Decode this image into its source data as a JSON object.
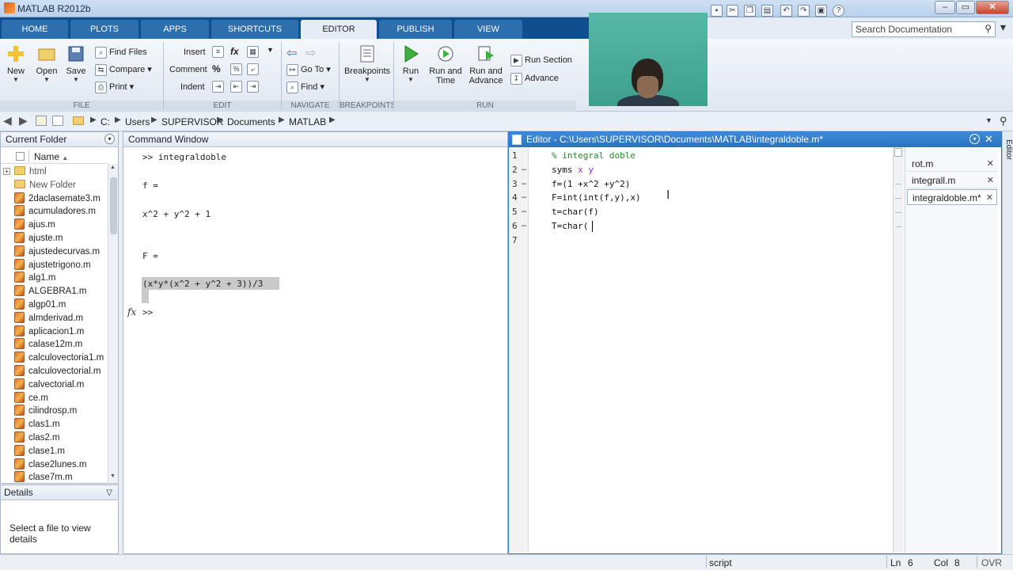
{
  "window": {
    "title": "MATLAB R2012b",
    "buttons": [
      "‒",
      "▭",
      "✕"
    ]
  },
  "tabs": [
    {
      "label": "HOME"
    },
    {
      "label": "PLOTS"
    },
    {
      "label": "APPS"
    },
    {
      "label": "SHORTCUTS"
    },
    {
      "label": "EDITOR"
    },
    {
      "label": "PUBLISH"
    },
    {
      "label": "VIEW"
    }
  ],
  "search": {
    "placeholder": "Search Documentation"
  },
  "ribbon": {
    "file": {
      "new": "New",
      "open": "Open",
      "save": "Save",
      "find_files": "Find Files",
      "compare": "Compare",
      "print": "Print",
      "section": "FILE"
    },
    "edit": {
      "insert": "Insert",
      "comment": "Comment",
      "indent": "Indent",
      "section": "EDIT"
    },
    "navigate": {
      "go_to": "Go To",
      "find": "Find",
      "section": "NAVIGATE"
    },
    "breakpoints": {
      "label": "Breakpoints",
      "section": "BREAKPOINTS"
    },
    "run": {
      "run": "Run",
      "run_and_time": [
        "Run and",
        "Time"
      ],
      "run_and_advance": [
        "Run and",
        "Advance"
      ],
      "run_section": "Run Section",
      "advance": "Advance",
      "section": "RUN"
    }
  },
  "address": [
    "C:",
    "Users",
    "SUPERVISOR",
    "Documents",
    "MATLAB"
  ],
  "current_folder": {
    "title": "Current Folder",
    "column": "Name",
    "sort": "▲",
    "items": [
      {
        "name": "html",
        "type": "folder"
      },
      {
        "name": "New Folder",
        "type": "folder"
      },
      {
        "name": "2daclasemate3.m",
        "type": "m"
      },
      {
        "name": "acumuladores.m",
        "type": "m"
      },
      {
        "name": "ajus.m",
        "type": "m"
      },
      {
        "name": "ajuste.m",
        "type": "m"
      },
      {
        "name": "ajustedecurvas.m",
        "type": "m"
      },
      {
        "name": "ajustetrigono.m",
        "type": "m"
      },
      {
        "name": "alg1.m",
        "type": "m"
      },
      {
        "name": "ALGEBRA1.m",
        "type": "m"
      },
      {
        "name": "algp01.m",
        "type": "m"
      },
      {
        "name": "almderivad.m",
        "type": "m"
      },
      {
        "name": "aplicacion1.m",
        "type": "m"
      },
      {
        "name": "calase12m.m",
        "type": "m"
      },
      {
        "name": "calculovectoria1.m",
        "type": "m"
      },
      {
        "name": "calculovectorial.m",
        "type": "m"
      },
      {
        "name": "calvectorial.m",
        "type": "m"
      },
      {
        "name": "ce.m",
        "type": "m"
      },
      {
        "name": "cilindrosp.m",
        "type": "m"
      },
      {
        "name": "clas1.m",
        "type": "m"
      },
      {
        "name": "clas2.m",
        "type": "m"
      },
      {
        "name": "clase1.m",
        "type": "m"
      },
      {
        "name": "clase2lunes.m",
        "type": "m"
      },
      {
        "name": "clase7m.m",
        "type": "m"
      }
    ]
  },
  "details": {
    "title": "Details",
    "message": "Select a file to view details"
  },
  "command_window": {
    "title": "Command Window",
    "lines": [
      ">> integraldoble",
      "f =",
      "x^2 + y^2 + 1",
      "F =",
      "(x*y*(x^2 + y^2 + 3))/3",
      ">>"
    ],
    "fx": "fx"
  },
  "editor": {
    "title": "Editor - C:\\Users\\SUPERVISOR\\Documents\\MATLAB\\integraldoble.m*",
    "side_label": "Editor",
    "line_numbers": [
      "1",
      "2",
      "3",
      "4",
      "5",
      "6",
      "7"
    ],
    "code": [
      {
        "comment": "% integral doble"
      },
      {
        "kw": "syms ",
        "vars": "x y"
      },
      {
        "text": "f=(1 +x^2 +y^2)"
      },
      {
        "text": "F=int(int(f,y),x)"
      },
      {
        "text": "t=char(f)"
      },
      {
        "text": "T=char("
      },
      {
        "text": ""
      }
    ],
    "files": [
      {
        "name": "rot.m"
      },
      {
        "name": "integrall.m"
      },
      {
        "name": "integraldoble.m*"
      }
    ]
  },
  "status": {
    "mode": "script",
    "ln_label": "Ln",
    "ln": "6",
    "col_label": "Col",
    "col": "8",
    "ovr": "OVR"
  }
}
